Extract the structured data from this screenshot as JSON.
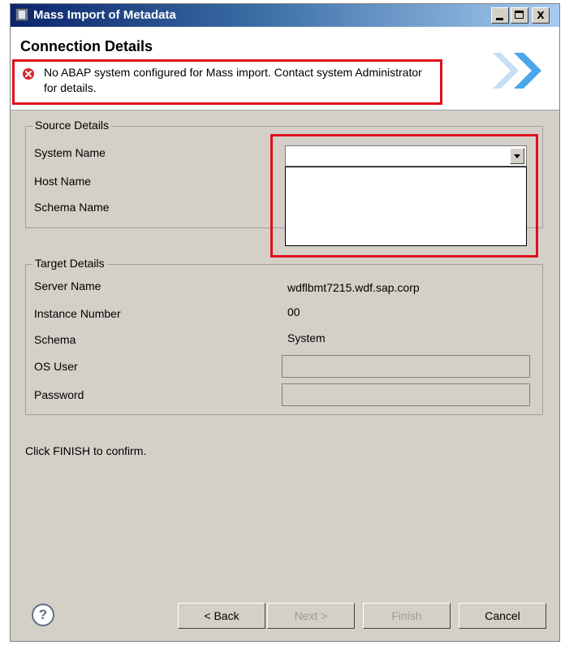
{
  "window": {
    "title": "Mass Import of Metadata",
    "controls": {
      "minimize_icon": "minimize-icon",
      "maximize_icon": "maximize-icon",
      "close_label": "X"
    }
  },
  "header": {
    "title": "Connection Details",
    "error_message": "No ABAP system configured for Mass import. Contact system Administrator for details.",
    "error_icon": "error-icon"
  },
  "source": {
    "group_label": "Source Details",
    "system_name_label": "System Name",
    "host_name_label": "Host Name",
    "schema_name_label": "Schema Name",
    "system_name_value": "",
    "dropdown_options": []
  },
  "target": {
    "group_label": "Target Details",
    "server_name_label": "Server Name",
    "server_name_value": "wdflbmt7215.wdf.sap.corp",
    "instance_number_label": "Instance Number",
    "instance_number_value": "00",
    "schema_label": "Schema",
    "schema_value": "System",
    "os_user_label": "OS User",
    "os_user_value": "",
    "password_label": "Password",
    "password_value": ""
  },
  "footer_text": "Click FINISH to confirm.",
  "buttons": {
    "help_label": "?",
    "back_label": "< Back",
    "next_label": "Next >",
    "finish_label": "Finish",
    "cancel_label": "Cancel"
  },
  "colors": {
    "highlight_border": "#e0101c",
    "dialog_bg": "#d4d0c8"
  }
}
